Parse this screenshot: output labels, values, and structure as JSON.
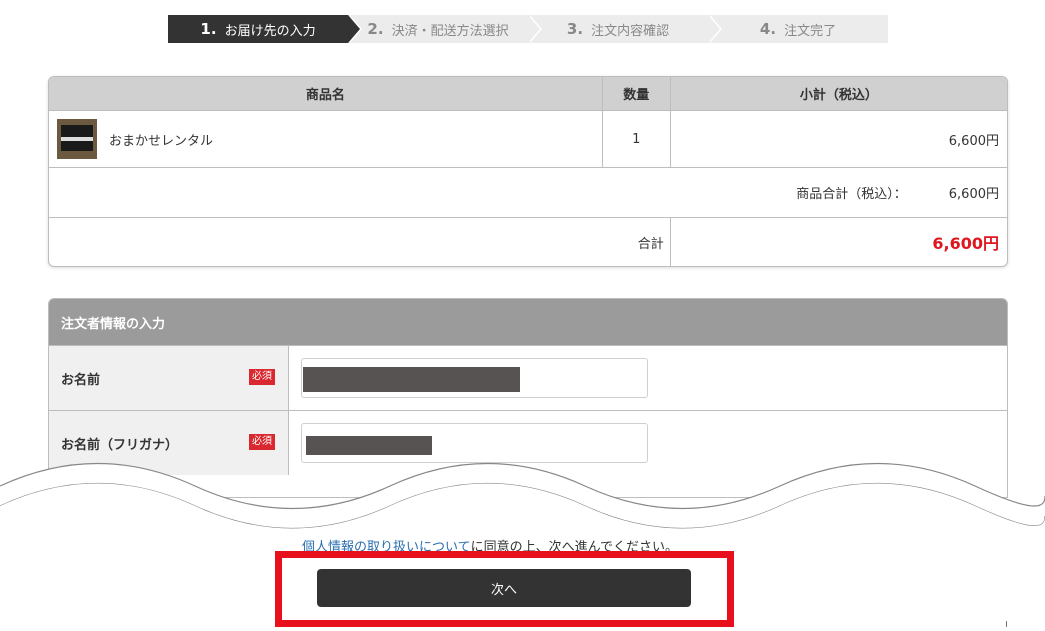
{
  "steps": [
    {
      "num": "1.",
      "label": "お届け先の入力"
    },
    {
      "num": "2.",
      "label": "決済・配送方法選択"
    },
    {
      "num": "3.",
      "label": "注文内容確認"
    },
    {
      "num": "4.",
      "label": "注文完了"
    }
  ],
  "cart": {
    "headers": {
      "product": "商品名",
      "qty": "数量",
      "subtotal": "小計（税込）"
    },
    "items": [
      {
        "name": "おまかせレンタル",
        "qty": "1",
        "subtotal": "6,600円"
      }
    ],
    "subtotal_label": "商品合計（税込）：",
    "subtotal_value": "6,600円",
    "total_label": "合計",
    "total_value": "6,600円"
  },
  "form": {
    "title": "注文者情報の入力",
    "fields": [
      {
        "label": "お名前",
        "required": "必須"
      },
      {
        "label": "お名前（フリガナ）",
        "required": "必須"
      }
    ]
  },
  "footer": {
    "privacy_link": "個人情報の取り扱いについて",
    "consent_text": "に同意の上、次へ進んでください。",
    "next_label": "次へ"
  },
  "colors": {
    "accent_red": "#e0161f",
    "dark": "#333333",
    "highlight": "#e8101c",
    "link": "#2a6fb0"
  }
}
